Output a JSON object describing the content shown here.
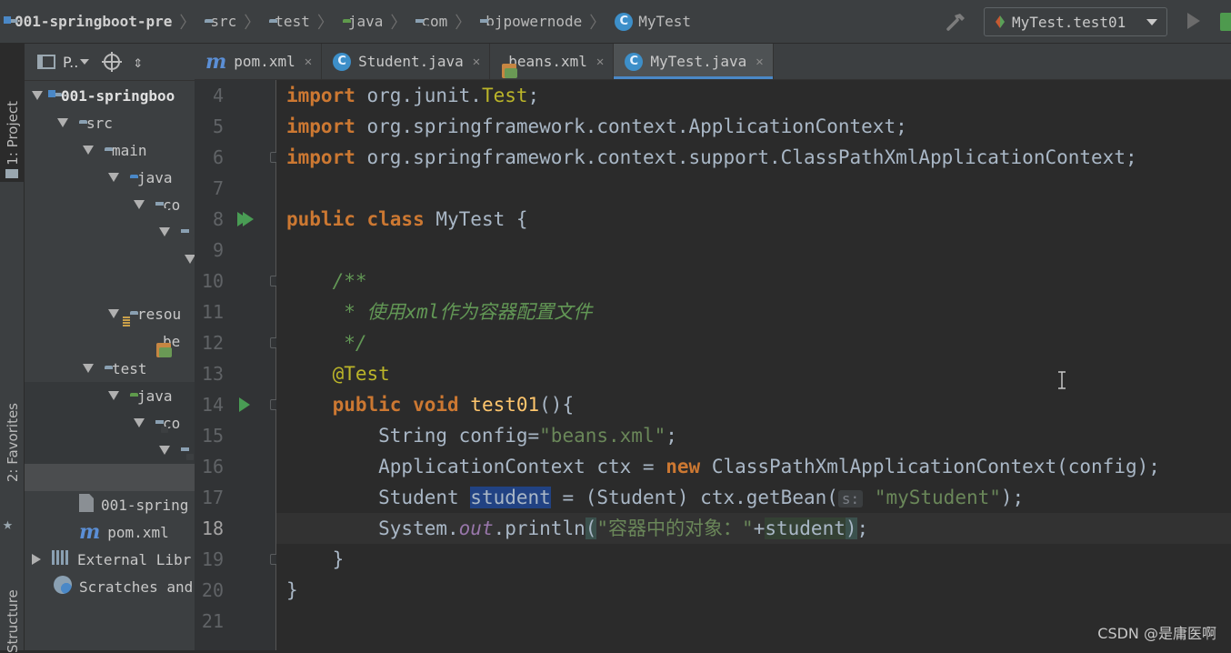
{
  "breadcrumb": [
    {
      "label": "001-springboot-pre",
      "icon": "module-folder-icon"
    },
    {
      "label": "src",
      "icon": "folder-icon"
    },
    {
      "label": "test",
      "icon": "folder-icon"
    },
    {
      "label": "java",
      "icon": "test-source-folder-icon"
    },
    {
      "label": "com",
      "icon": "package-icon"
    },
    {
      "label": "bjpowernode",
      "icon": "package-icon"
    },
    {
      "label": "MyTest",
      "icon": "class-icon"
    }
  ],
  "run_config": {
    "label": "MyTest.test01"
  },
  "left_strip": {
    "project": "1: Project",
    "favorites": "2: Favorites",
    "structure": "Structure"
  },
  "project_panel": {
    "title": "P..",
    "tree": [
      {
        "label": "001-springboo",
        "icon": "module-folder-icon",
        "arrow": "down",
        "bold": true
      },
      {
        "label": "src",
        "icon": "folder-icon",
        "arrow": "down"
      },
      {
        "label": "main",
        "icon": "folder-icon",
        "arrow": "down"
      },
      {
        "label": "java",
        "icon": "source-folder-icon",
        "arrow": "down"
      },
      {
        "label": "co",
        "icon": "package-icon",
        "arrow": "down"
      },
      {
        "label": "",
        "icon": "package-icon",
        "arrow": "down"
      },
      {
        "label": "",
        "icon": "",
        "arrow": "down"
      },
      {
        "label": "",
        "icon": "",
        "arrow": "none"
      },
      {
        "label": "resou",
        "icon": "resources-folder-icon",
        "arrow": "down"
      },
      {
        "label": "be",
        "icon": "xml-file-icon",
        "arrow": "none"
      },
      {
        "label": "test",
        "icon": "folder-icon",
        "arrow": "down"
      },
      {
        "label": "java",
        "icon": "test-source-folder-icon",
        "arrow": "down"
      },
      {
        "label": "co",
        "icon": "package-icon",
        "arrow": "down"
      },
      {
        "label": "",
        "icon": "package-icon",
        "arrow": "down"
      },
      {
        "label": "",
        "icon": "",
        "arrow": "none"
      },
      {
        "label": "001-spring",
        "icon": "iml-file-icon",
        "arrow": "none"
      },
      {
        "label": "pom.xml",
        "icon": "maven-icon",
        "arrow": "none"
      },
      {
        "label": "External Libr",
        "icon": "library-icon",
        "arrow": "right"
      },
      {
        "label": "Scratches and",
        "icon": "scratches-icon",
        "arrow": "none"
      }
    ]
  },
  "tabs": [
    {
      "label": "pom.xml",
      "icon": "maven-icon",
      "active": false
    },
    {
      "label": "Student.java",
      "icon": "class-icon",
      "active": false
    },
    {
      "label": "beans.xml",
      "icon": "xml-file-icon",
      "active": false
    },
    {
      "label": "MyTest.java",
      "icon": "class-icon",
      "active": true
    }
  ],
  "editor": {
    "current_line": 18,
    "lines": [
      {
        "n": "4",
        "tokens": [
          [
            "kw",
            "import "
          ],
          [
            "pk",
            "org.junit."
          ],
          [
            "an",
            "Test"
          ],
          [
            "id",
            ";"
          ]
        ]
      },
      {
        "n": "5",
        "tokens": [
          [
            "kw",
            "import "
          ],
          [
            "pk",
            "org.springframework.context.ApplicationContext"
          ],
          [
            "id",
            ";"
          ]
        ]
      },
      {
        "n": "6",
        "tokens": [
          [
            "kw",
            "import "
          ],
          [
            "pk",
            "org.springframework.context.support.ClassPathXmlApplicationContext"
          ],
          [
            "id",
            ";"
          ]
        ]
      },
      {
        "n": "7",
        "tokens": []
      },
      {
        "n": "8",
        "tokens": [
          [
            "kw",
            "public class "
          ],
          [
            "id",
            "MyTest {"
          ]
        ]
      },
      {
        "n": "9",
        "tokens": []
      },
      {
        "n": "10",
        "tokens": [
          [
            "cm",
            "    /**"
          ]
        ]
      },
      {
        "n": "11",
        "tokens": [
          [
            "cm",
            "     * 使用xml作为容器配置文件"
          ]
        ]
      },
      {
        "n": "12",
        "tokens": [
          [
            "cm",
            "     */"
          ]
        ]
      },
      {
        "n": "13",
        "tokens": [
          [
            "an",
            "    @Test"
          ]
        ]
      },
      {
        "n": "14",
        "tokens": [
          [
            "kw",
            "    public void "
          ],
          [
            "fn",
            "test01"
          ],
          [
            "id",
            "(){"
          ]
        ]
      },
      {
        "n": "15",
        "tokens": [
          [
            "id",
            "        String config="
          ],
          [
            "st",
            "\"beans.xml\""
          ],
          [
            "id",
            ";"
          ]
        ]
      },
      {
        "n": "16",
        "tokens": [
          [
            "id",
            "        ApplicationContext ctx = "
          ],
          [
            "kw",
            "new "
          ],
          [
            "id",
            "ClassPathXmlApplicationContext(config);"
          ]
        ]
      },
      {
        "n": "17",
        "tokens": [
          [
            "id",
            "        Student "
          ],
          [
            "sel",
            "student"
          ],
          [
            "id",
            " = (Student) ctx.getBean("
          ],
          [
            "hint",
            "s:"
          ],
          [
            "id",
            " "
          ],
          [
            "st",
            "\"myStudent\""
          ],
          [
            "id",
            ");"
          ]
        ]
      },
      {
        "n": "18",
        "tokens": [
          [
            "id",
            "        System."
          ],
          [
            "it",
            "out"
          ],
          [
            "id",
            ".println"
          ],
          [
            "br",
            "("
          ],
          [
            "st",
            "\"容器中的对象：\""
          ],
          [
            "id",
            "+"
          ],
          [
            "ref",
            "student"
          ],
          [
            "br",
            ")"
          ],
          [
            "id",
            ";"
          ]
        ]
      },
      {
        "n": "19",
        "tokens": [
          [
            "id",
            "    }"
          ]
        ]
      },
      {
        "n": "20",
        "tokens": [
          [
            "id",
            "}"
          ]
        ]
      },
      {
        "n": "21",
        "tokens": []
      }
    ]
  },
  "watermark": "CSDN @是庸医啊",
  "colors": {
    "accent": "#4a88c7",
    "keyword": "#cc7832",
    "string": "#6a8759",
    "comment": "#629755",
    "annotation": "#bbb529",
    "method": "#ffc66d",
    "selection": "#214283"
  }
}
